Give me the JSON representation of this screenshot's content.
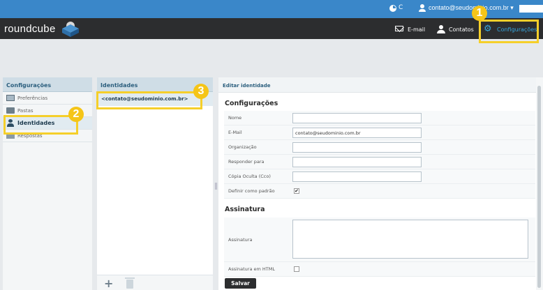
{
  "topbar": {
    "pie_letter": "C",
    "user_email": "contato@seudominio.com.br ▾"
  },
  "header": {
    "logo": "roundcube",
    "nav": {
      "email": "E-mail",
      "contacts": "Contatos",
      "settings": "Configurações"
    }
  },
  "left_panel": {
    "title": "Configurações",
    "items": [
      {
        "label": "Preferências"
      },
      {
        "label": "Pastas"
      },
      {
        "label": "Identidades"
      },
      {
        "label": "Respostas"
      }
    ]
  },
  "middle_panel": {
    "title": "Identidades",
    "identity": "<contato@seudominio.com.br>"
  },
  "right_panel": {
    "title": "Editar identidade",
    "section1": "Configurações",
    "fields": [
      {
        "label": "Nome",
        "value": ""
      },
      {
        "label": "E-Mail",
        "value": "contato@seudominio.com.br"
      },
      {
        "label": "Organização",
        "value": ""
      },
      {
        "label": "Responder para",
        "value": ""
      },
      {
        "label": "Cópia Oculta (Cco)",
        "value": ""
      }
    ],
    "default_label": "Definir como padrão",
    "default_checked": "✔",
    "section2": "Assinatura",
    "signature_label": "Assinatura",
    "html_signature_label": "Assinatura em HTML",
    "save": "Salvar"
  },
  "callouts": [
    "1",
    "2",
    "3"
  ],
  "colors": {
    "topbar": "#3a87c9",
    "header": "#2c2d2f",
    "callout": "#f5c518"
  }
}
